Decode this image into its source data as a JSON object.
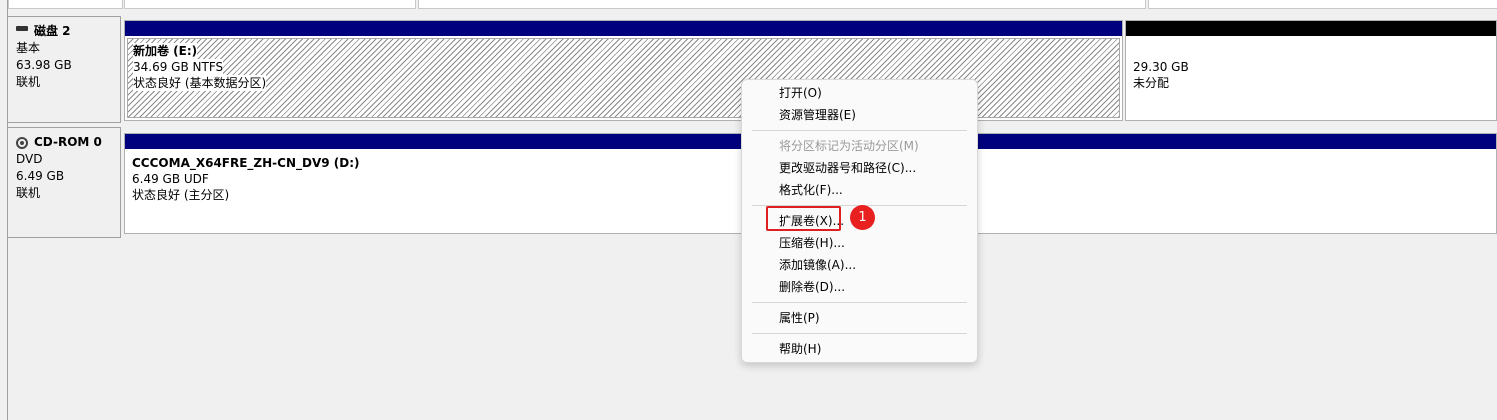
{
  "disks": [
    {
      "name": "磁盘 2",
      "icon": "disk-icon",
      "type": "基本",
      "size": "63.98 GB",
      "status": "联机",
      "partitions": [
        {
          "label": "新加卷  (E:)",
          "size_fs": "34.69 GB NTFS",
          "status": "状态良好 (基本数据分区)",
          "bar_color": "#00007f"
        },
        {
          "label": "",
          "size_fs": "29.30 GB",
          "status": "未分配",
          "bar_color": "#000000"
        }
      ]
    },
    {
      "name": "CD-ROM 0",
      "icon": "cdrom-icon",
      "type": "DVD",
      "size": "6.49 GB",
      "status": "联机",
      "partitions": [
        {
          "label": "CCCOMA_X64FRE_ZH-CN_DV9  (D:)",
          "size_fs": "6.49 GB UDF",
          "status": "状态良好 (主分区)",
          "bar_color": "#00007f"
        }
      ]
    }
  ],
  "context_menu": {
    "items": [
      {
        "label": "打开(O)",
        "enabled": true
      },
      {
        "label": "资源管理器(E)",
        "enabled": true
      },
      {
        "label": "将分区标记为活动分区(M)",
        "enabled": false
      },
      {
        "label": "更改驱动器号和路径(C)...",
        "enabled": true
      },
      {
        "label": "格式化(F)...",
        "enabled": true
      },
      {
        "label": "扩展卷(X)...",
        "enabled": true,
        "highlighted": true
      },
      {
        "label": "压缩卷(H)...",
        "enabled": true
      },
      {
        "label": "添加镜像(A)...",
        "enabled": true
      },
      {
        "label": "删除卷(D)...",
        "enabled": true
      },
      {
        "label": "属性(P)",
        "enabled": true
      },
      {
        "label": "帮助(H)",
        "enabled": true
      }
    ]
  },
  "annotation": {
    "badge": "1",
    "color": "#e8201f"
  }
}
